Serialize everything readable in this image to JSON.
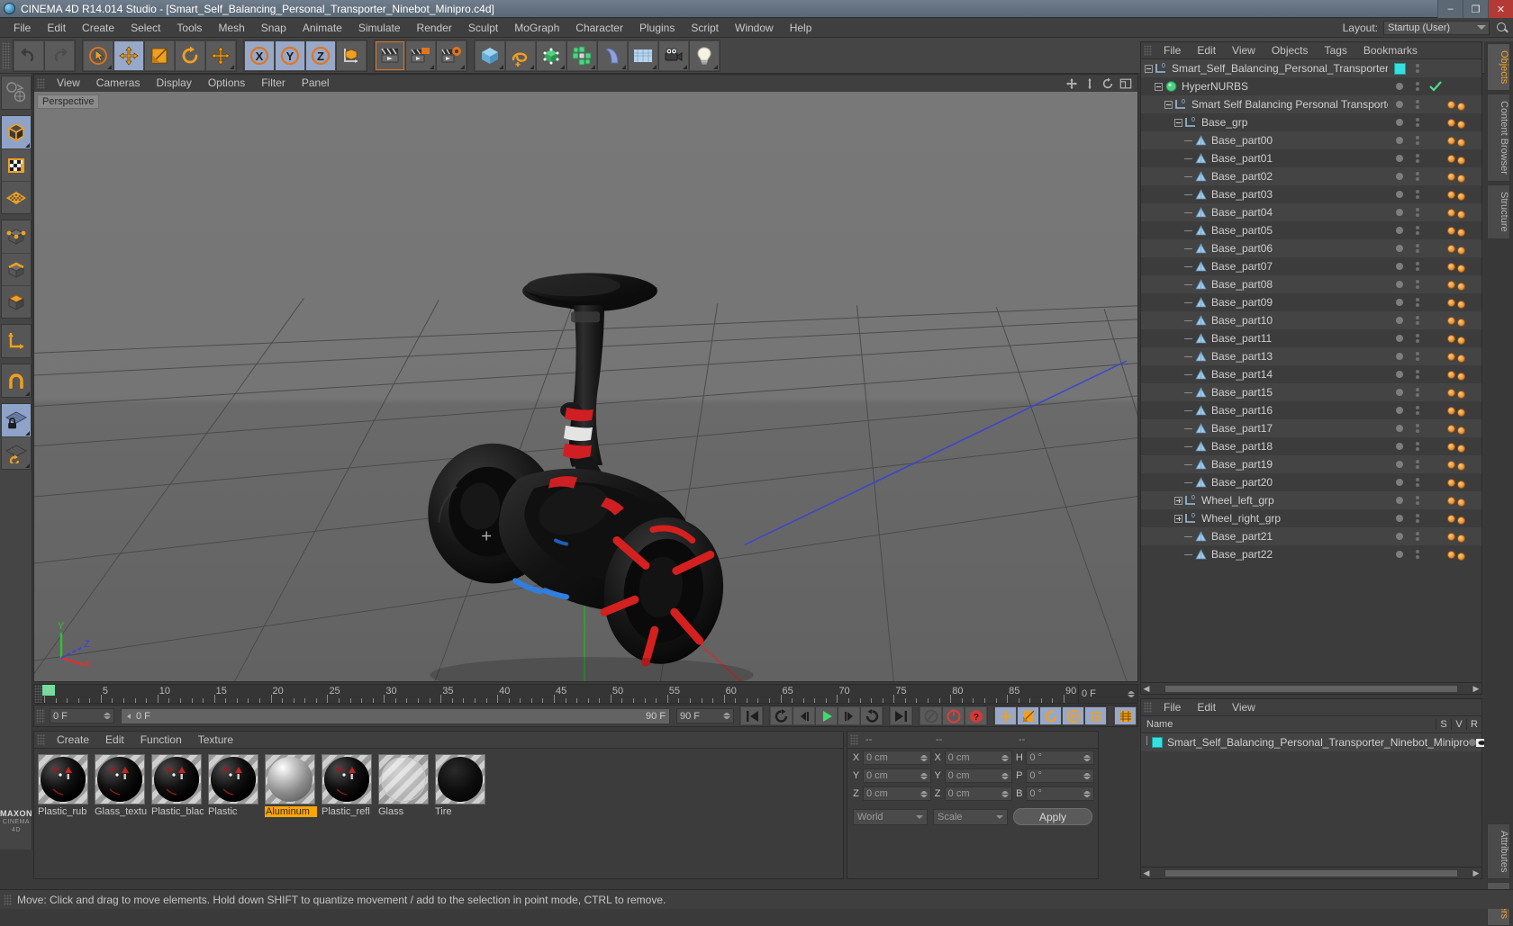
{
  "window": {
    "title": "CINEMA 4D R14.014 Studio - [Smart_Self_Balancing_Personal_Transporter_Ninebot_Minipro.c4d]",
    "minimize": "–",
    "maximize": "❐",
    "close": "✕"
  },
  "menubar": {
    "items": [
      "File",
      "Edit",
      "Create",
      "Select",
      "Tools",
      "Mesh",
      "Snap",
      "Animate",
      "Simulate",
      "Render",
      "Sculpt",
      "MoGraph",
      "Character",
      "Plugins",
      "Script",
      "Window",
      "Help"
    ],
    "layout_label": "Layout:",
    "layout_value": "Startup (User)"
  },
  "viewport": {
    "menu": [
      "View",
      "Cameras",
      "Display",
      "Options",
      "Filter",
      "Panel"
    ],
    "label": "Perspective",
    "axis": {
      "x": "X",
      "y": "Y",
      "z": "Z"
    }
  },
  "timeline": {
    "ticks": [
      0,
      5,
      10,
      15,
      20,
      25,
      30,
      35,
      40,
      45,
      50,
      55,
      60,
      65,
      70,
      75,
      80,
      85,
      90
    ],
    "current_frame": "0 F",
    "end_frame": "90 F",
    "range_start": "0 F",
    "range_end": "90 F",
    "field_start": "0 F",
    "field_end": "90 F"
  },
  "materials": {
    "menu": [
      "Create",
      "Edit",
      "Function",
      "Texture"
    ],
    "items": [
      {
        "name": "Plastic_rub",
        "selected": false,
        "kind": "dark-plastic"
      },
      {
        "name": "Glass_textu",
        "selected": false,
        "kind": "dark-plastic"
      },
      {
        "name": "Plastic_blac",
        "selected": false,
        "kind": "dark-plastic"
      },
      {
        "name": "Plastic",
        "selected": false,
        "kind": "dark-plastic"
      },
      {
        "name": "Aluminum",
        "selected": true,
        "kind": "metal"
      },
      {
        "name": "Plastic_refl",
        "selected": false,
        "kind": "dark-plastic"
      },
      {
        "name": "Glass",
        "selected": false,
        "kind": "glass"
      },
      {
        "name": "Tire",
        "selected": false,
        "kind": "tire"
      }
    ]
  },
  "coordinates": {
    "header": [
      "--",
      "--",
      "--"
    ],
    "rows": [
      {
        "pos_label": "X",
        "pos_value": "0 cm",
        "size_label": "X",
        "size_value": "0 cm",
        "rot_label": "H",
        "rot_value": "0 °"
      },
      {
        "pos_label": "Y",
        "pos_value": "0 cm",
        "size_label": "Y",
        "size_value": "0 cm",
        "rot_label": "P",
        "rot_value": "0 °"
      },
      {
        "pos_label": "Z",
        "pos_value": "0 cm",
        "size_label": "Z",
        "size_value": "0 cm",
        "rot_label": "B",
        "rot_value": "0 °"
      }
    ],
    "system": "World",
    "mode": "Scale",
    "apply": "Apply"
  },
  "objects": {
    "menu": [
      "File",
      "Edit",
      "View",
      "Objects",
      "Tags",
      "Bookmarks"
    ],
    "items": [
      {
        "label": "Smart_Self_Balancing_Personal_Transporter_Ninebot_Minipro",
        "depth": 0,
        "icon": "null",
        "expander": "minus",
        "swatch": "cyan",
        "check": false,
        "mat": false
      },
      {
        "label": "HyperNURBS",
        "depth": 1,
        "icon": "hypernurbs",
        "expander": "minus",
        "swatch": "dot",
        "check": true,
        "mat": false
      },
      {
        "label": "Smart Self Balancing Personal Transporter",
        "depth": 2,
        "icon": "null",
        "expander": "minus",
        "swatch": "dot",
        "check": false,
        "mat": true
      },
      {
        "label": "Base_grp",
        "depth": 3,
        "icon": "null",
        "expander": "minus",
        "swatch": "dot",
        "check": false,
        "mat": true
      },
      {
        "label": "Base_part00",
        "depth": 4,
        "icon": "poly",
        "expander": "none",
        "swatch": "dot",
        "check": false,
        "mat": true
      },
      {
        "label": "Base_part01",
        "depth": 4,
        "icon": "poly",
        "expander": "none",
        "swatch": "dot",
        "check": false,
        "mat": true
      },
      {
        "label": "Base_part02",
        "depth": 4,
        "icon": "poly",
        "expander": "none",
        "swatch": "dot",
        "check": false,
        "mat": true
      },
      {
        "label": "Base_part03",
        "depth": 4,
        "icon": "poly",
        "expander": "none",
        "swatch": "dot",
        "check": false,
        "mat": true
      },
      {
        "label": "Base_part04",
        "depth": 4,
        "icon": "poly",
        "expander": "none",
        "swatch": "dot",
        "check": false,
        "mat": true
      },
      {
        "label": "Base_part05",
        "depth": 4,
        "icon": "poly",
        "expander": "none",
        "swatch": "dot",
        "check": false,
        "mat": true
      },
      {
        "label": "Base_part06",
        "depth": 4,
        "icon": "poly",
        "expander": "none",
        "swatch": "dot",
        "check": false,
        "mat": true
      },
      {
        "label": "Base_part07",
        "depth": 4,
        "icon": "poly",
        "expander": "none",
        "swatch": "dot",
        "check": false,
        "mat": true
      },
      {
        "label": "Base_part08",
        "depth": 4,
        "icon": "poly",
        "expander": "none",
        "swatch": "dot",
        "check": false,
        "mat": true
      },
      {
        "label": "Base_part09",
        "depth": 4,
        "icon": "poly",
        "expander": "none",
        "swatch": "dot",
        "check": false,
        "mat": true
      },
      {
        "label": "Base_part10",
        "depth": 4,
        "icon": "poly",
        "expander": "none",
        "swatch": "dot",
        "check": false,
        "mat": true
      },
      {
        "label": "Base_part11",
        "depth": 4,
        "icon": "poly",
        "expander": "none",
        "swatch": "dot",
        "check": false,
        "mat": true
      },
      {
        "label": "Base_part13",
        "depth": 4,
        "icon": "poly",
        "expander": "none",
        "swatch": "dot",
        "check": false,
        "mat": true
      },
      {
        "label": "Base_part14",
        "depth": 4,
        "icon": "poly",
        "expander": "none",
        "swatch": "dot",
        "check": false,
        "mat": true
      },
      {
        "label": "Base_part15",
        "depth": 4,
        "icon": "poly",
        "expander": "none",
        "swatch": "dot",
        "check": false,
        "mat": true
      },
      {
        "label": "Base_part16",
        "depth": 4,
        "icon": "poly",
        "expander": "none",
        "swatch": "dot",
        "check": false,
        "mat": true
      },
      {
        "label": "Base_part17",
        "depth": 4,
        "icon": "poly",
        "expander": "none",
        "swatch": "dot",
        "check": false,
        "mat": true
      },
      {
        "label": "Base_part18",
        "depth": 4,
        "icon": "poly",
        "expander": "none",
        "swatch": "dot",
        "check": false,
        "mat": true
      },
      {
        "label": "Base_part19",
        "depth": 4,
        "icon": "poly",
        "expander": "none",
        "swatch": "dot",
        "check": false,
        "mat": true
      },
      {
        "label": "Base_part20",
        "depth": 4,
        "icon": "poly",
        "expander": "none",
        "swatch": "dot",
        "check": false,
        "mat": true
      },
      {
        "label": "Wheel_left_grp",
        "depth": 3,
        "icon": "null",
        "expander": "plus",
        "swatch": "dot",
        "check": false,
        "mat": true
      },
      {
        "label": "Wheel_right_grp",
        "depth": 3,
        "icon": "null",
        "expander": "plus",
        "swatch": "dot",
        "check": false,
        "mat": true
      },
      {
        "label": "Base_part21",
        "depth": 4,
        "icon": "poly",
        "expander": "none",
        "swatch": "dot",
        "check": false,
        "mat": true
      },
      {
        "label": "Base_part22",
        "depth": 4,
        "icon": "poly",
        "expander": "none",
        "swatch": "dot",
        "check": false,
        "mat": true
      }
    ]
  },
  "layers": {
    "menu": [
      "File",
      "Edit",
      "View"
    ],
    "columns": {
      "name": "Name",
      "s": "S",
      "v": "V",
      "r": "R"
    },
    "rows": [
      {
        "name": "Smart_Self_Balancing_Personal_Transporter_Ninebot_Minipro",
        "color": "#37e0e0"
      }
    ]
  },
  "side_tabs": {
    "top": [
      {
        "label": "Objects",
        "active": true
      },
      {
        "label": "Content Browser",
        "active": false
      },
      {
        "label": "Structure",
        "active": false
      }
    ],
    "bottom": [
      {
        "label": "Attributes",
        "active": false
      },
      {
        "label": "Layers",
        "active": true
      }
    ]
  },
  "statusbar": {
    "text": "Move: Click and drag to move elements. Hold down SHIFT to quantize movement / add to the selection in point mode, CTRL to remove."
  },
  "toolbar": {
    "groups": [
      {
        "buttons": [
          {
            "name": "undo-icon",
            "active": false
          },
          {
            "name": "redo-icon",
            "active": false
          }
        ]
      },
      {
        "buttons": [
          {
            "name": "select-tool-icon",
            "active": false
          },
          {
            "name": "move-tool-icon",
            "active": true
          },
          {
            "name": "scale-tool-icon",
            "active": false
          },
          {
            "name": "rotate-tool-icon",
            "active": false
          },
          {
            "name": "move-axis-icon",
            "active": false
          }
        ]
      },
      {
        "buttons": [
          {
            "name": "lock-x-axis-icon",
            "active": true
          },
          {
            "name": "lock-y-axis-icon",
            "active": true
          },
          {
            "name": "lock-z-axis-icon",
            "active": true
          },
          {
            "name": "world-coordinates-icon",
            "active": false
          }
        ]
      },
      {
        "buttons": [
          {
            "name": "render-view-icon",
            "active": false
          },
          {
            "name": "render-region-icon",
            "active": false
          },
          {
            "name": "render-settings-icon",
            "active": false
          }
        ]
      },
      {
        "buttons": [
          {
            "name": "cube-primitive-icon",
            "active": false
          },
          {
            "name": "spline-icon",
            "active": false
          },
          {
            "name": "hypernurbs-icon",
            "active": false
          },
          {
            "name": "array-icon",
            "active": false
          },
          {
            "name": "bend-deformer-icon",
            "active": false
          },
          {
            "name": "floor-environment-icon",
            "active": false
          },
          {
            "name": "camera-icon",
            "active": false
          },
          {
            "name": "light-icon",
            "active": false
          }
        ]
      }
    ]
  },
  "leftbar": {
    "groups": [
      [
        {
          "name": "make-editable-icon",
          "active": false
        }
      ],
      [
        {
          "name": "model-mode-icon",
          "active": true
        },
        {
          "name": "texture-mode-icon",
          "active": false
        },
        {
          "name": "polygon-grid-icon",
          "active": false
        }
      ],
      [
        {
          "name": "points-mode-icon",
          "active": false
        },
        {
          "name": "edges-mode-icon",
          "active": false
        },
        {
          "name": "polygons-mode-icon",
          "active": false
        }
      ],
      [
        {
          "name": "object-axis-icon",
          "active": false
        }
      ],
      [
        {
          "name": "snap-magnet-icon",
          "active": false
        }
      ],
      [
        {
          "name": "lock-workplane-icon",
          "active": true
        },
        {
          "name": "workplane-icon",
          "active": false
        }
      ]
    ],
    "brand_top": "MAXON",
    "brand_bottom": "CINEMA 4D"
  }
}
